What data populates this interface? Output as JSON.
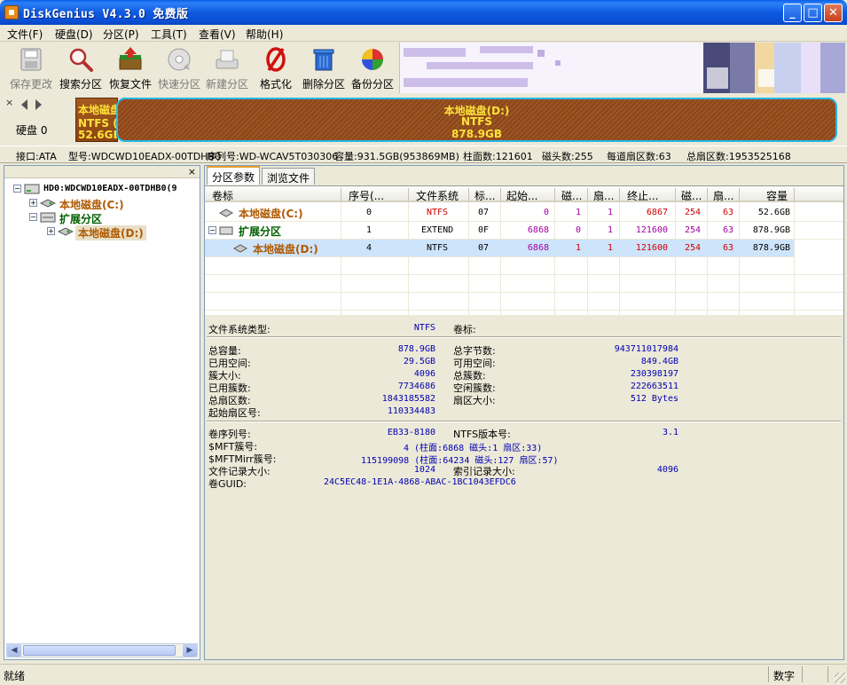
{
  "window": {
    "title": "DiskGenius V4.3.0 免费版",
    "min": "_",
    "max": "□",
    "close": "✕"
  },
  "menu": [
    "文件(F)",
    "硬盘(D)",
    "分区(P)",
    "工具(T)",
    "查看(V)",
    "帮助(H)"
  ],
  "toolbar": [
    {
      "label": "保存更改",
      "icon": "save-icon",
      "enabled": false
    },
    {
      "label": "搜索分区",
      "icon": "magnifier-icon",
      "enabled": true
    },
    {
      "label": "恢复文件",
      "icon": "recover-box-icon",
      "enabled": true
    },
    {
      "label": "快速分区",
      "icon": "disc-icon",
      "enabled": false
    },
    {
      "label": "新建分区",
      "icon": "new-partition-icon",
      "enabled": false
    },
    {
      "label": "格式化",
      "icon": "format-icon",
      "enabled": true
    },
    {
      "label": "删除分区",
      "icon": "trash-icon",
      "enabled": true
    },
    {
      "label": "备份分区",
      "icon": "backup-icon",
      "enabled": true
    }
  ],
  "diskbar": {
    "disk_label": "硬盘 0",
    "partition_c": {
      "line1": "本地磁盘(C:)",
      "line2": "NTFS (活动)",
      "line3": "52.6GB"
    },
    "partition_d": {
      "line1": "本地磁盘(D:)",
      "line2": "NTFS",
      "line3": "878.9GB"
    }
  },
  "disk_info": {
    "iface": "接口:ATA",
    "model": "型号:WDCWD10EADX-00TDHB0",
    "serial": "序列号:WD-WCAV5T030306",
    "capacity": "容量:931.5GB(953869MB)",
    "cylinders": "柱面数:121601",
    "heads": "磁头数:255",
    "sectors_per_track": "每道扇区数:63",
    "total_sectors": "总扇区数:1953525168"
  },
  "tree": {
    "root": "HD0:WDCWD10EADX-00TDHB0(9",
    "c": "本地磁盘(C:)",
    "ext": "扩展分区",
    "d": "本地磁盘(D:)"
  },
  "tabs": [
    "分区参数",
    "浏览文件"
  ],
  "table": {
    "headers": [
      "卷标",
      "序号(...",
      "文件系统",
      "标...",
      "起始...",
      "磁...",
      "扇...",
      "终止...",
      "磁...",
      "扇...",
      "容量"
    ],
    "rows": [
      {
        "label": "本地磁盘(C:)",
        "seq": "0",
        "fs": "NTFS",
        "id": "07",
        "start_cyl": "0",
        "start_head": "1",
        "start_sec": "1",
        "end_cyl": "6867",
        "end_head": "254",
        "end_sec": "63",
        "size": "52.6GB"
      },
      {
        "label": "扩展分区",
        "seq": "1",
        "fs": "EXTEND",
        "id": "0F",
        "start_cyl": "6868",
        "start_head": "0",
        "start_sec": "1",
        "end_cyl": "121600",
        "end_head": "254",
        "end_sec": "63",
        "size": "878.9GB"
      },
      {
        "label": "本地磁盘(D:)",
        "seq": "4",
        "fs": "NTFS",
        "id": "07",
        "start_cyl": "6868",
        "start_head": "1",
        "start_sec": "1",
        "end_cyl": "121600",
        "end_head": "254",
        "end_sec": "63",
        "size": "878.9GB"
      }
    ]
  },
  "details": {
    "fs_type_label": "文件系统类型:",
    "fs_type": "NTFS",
    "vol_label_label": "卷标:",
    "total_cap_label": "总容量:",
    "total_cap": "878.9GB",
    "total_bytes_label": "总字节数:",
    "total_bytes": "943711017984",
    "used_label": "已用空间:",
    "used": "29.5GB",
    "free_label": "可用空间:",
    "free": "849.4GB",
    "cluster_size_label": "簇大小:",
    "cluster_size": "4096",
    "total_clusters_label": "总簇数:",
    "total_clusters": "230398197",
    "used_clusters_label": "已用簇数:",
    "used_clusters": "7734686",
    "free_clusters_label": "空闲簇数:",
    "free_clusters": "222663511",
    "total_sectors_label": "总扇区数:",
    "total_sectors": "1843185582",
    "sector_size_label": "扇区大小:",
    "sector_size": "512 Bytes",
    "start_sector_label": "起始扇区号:",
    "start_sector": "110334483",
    "serial_label": "卷序列号:",
    "serial": "EB33-8180",
    "ntfs_ver_label": "NTFS版本号:",
    "ntfs_ver": "3.1",
    "mft_label": "$MFT簇号:",
    "mft": "4 (柱面:6868 磁头:1 扇区:33)",
    "mftmirr_label": "$MFTMirr簇号:",
    "mftmirr": "115199098 (柱面:64234 磁头:127 扇区:57)",
    "frs_label": "文件记录大小:",
    "frs": "1024",
    "irs_label": "索引记录大小:",
    "irs": "4096",
    "guid_label": "卷GUID:",
    "guid": "24C5EC48-1E1A-4868-ABAC-1BC1043EFDC6"
  },
  "status": {
    "left": "就绪",
    "right": "数字"
  },
  "colors": {
    "title_blue": "#0b4fd6",
    "partition_brown": "#9c5524",
    "partition_text": "#ffe23a",
    "selected_row": "#cde4fb"
  }
}
